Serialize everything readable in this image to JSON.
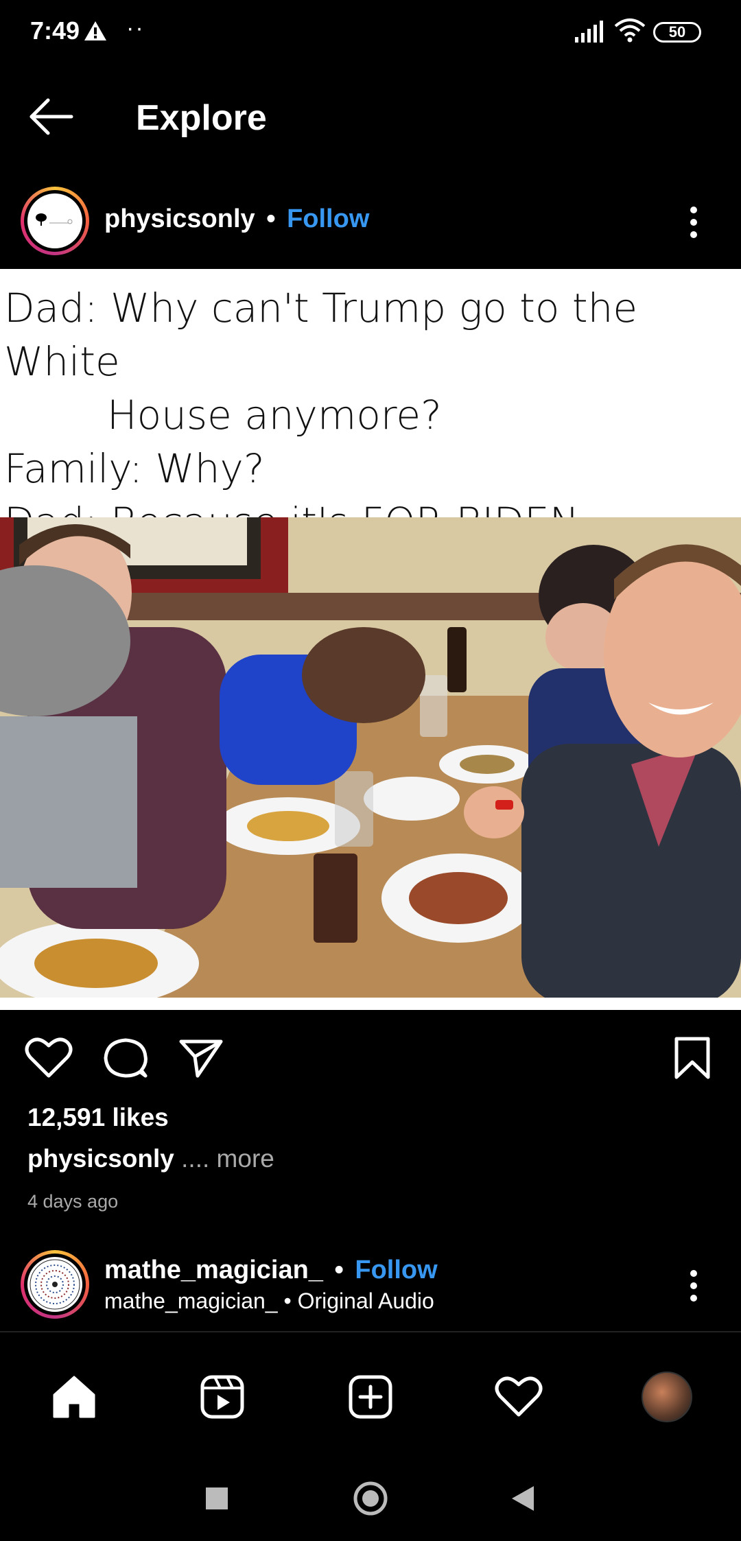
{
  "status_bar": {
    "time": "7:49",
    "battery": "50",
    "icons": [
      "alert-icon",
      "signal-icon",
      "wifi-icon",
      "battery-icon"
    ]
  },
  "header": {
    "title": "Explore"
  },
  "post": {
    "username": "physicsonly",
    "separator": "•",
    "follow_label": "Follow",
    "meme_lines": [
      "Dad: Why can't Trump go to the White",
      "House anymore?",
      "Family: Why?",
      "Dad: Because it's FOR BIDEN"
    ],
    "likes": "12,591 likes",
    "caption_user": "physicsonly",
    "caption_dots": " ....",
    "caption_more": " more",
    "time_ago": "4 days ago"
  },
  "next_post": {
    "username": "mathe_magician_",
    "separator": "•",
    "follow_label": "Follow",
    "subtitle": "mathe_magician_ • Original Audio"
  },
  "colors": {
    "background": "#000000",
    "link_blue": "#3897f0",
    "muted": "#aaaaaa"
  }
}
